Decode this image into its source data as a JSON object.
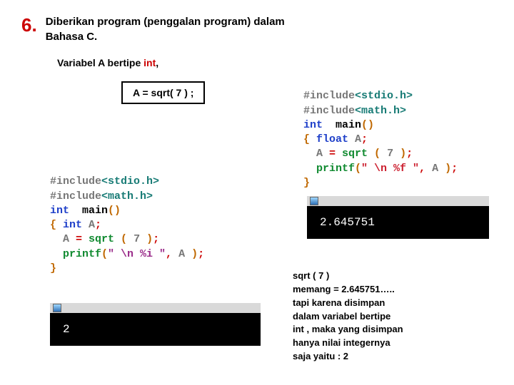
{
  "number": "6.",
  "title_line1": "Diberikan program (penggalan program) dalam",
  "title_line2": "Bahasa C.",
  "variable": {
    "pre": "Variabel   A   bertipe  ",
    "kw": "int",
    "post": ","
  },
  "formula": "A =  sqrt( 7 ) ;",
  "code_left": {
    "l1a": "#include",
    "l1b": "<stdio.h>",
    "l2a": "#include",
    "l2b": "<math.h>",
    "l3a": "int",
    "l3b": "  main",
    "l3c": "()",
    "l4a": "{",
    "l4b": " int",
    "l4c": " A",
    "l4d": ";",
    "l5a": "  A ",
    "l5b": "=",
    "l5c": " sqrt ",
    "l5d": "(",
    "l5e": " 7 ",
    "l5f": ")",
    "l5g": ";",
    "l6a": "  printf",
    "l6b": "(",
    "l6c": "\" \\n %i \"",
    "l6d": ", ",
    "l6e": "A ",
    "l6f": ")",
    "l6g": ";",
    "l7a": "}"
  },
  "code_right": {
    "l1a": "#include",
    "l1b": "<stdio.h>",
    "l2a": "#include",
    "l2b": "<math.h>",
    "l3a": "int",
    "l3b": "  main",
    "l3c": "()",
    "l4a": "{",
    "l4b": " float",
    "l4c": " A",
    "l4d": ";",
    "l5a": "  A ",
    "l5b": "=",
    "l5c": " sqrt ",
    "l5d": "(",
    "l5e": " 7 ",
    "l5f": ")",
    "l5g": ";",
    "l6a": "  printf",
    "l6b": "(",
    "l6c": "\" \\n %f \"",
    "l6d": ", ",
    "l6e": "A ",
    "l6f": ")",
    "l6g": ";",
    "l7a": "}"
  },
  "output_left": "2",
  "output_right": "2.645751",
  "explain": {
    "l1": "sqrt ( 7 )",
    "l2": "memang = 2.645751…..",
    "l3": "tapi karena disimpan",
    "l4": "dalam variabel bertipe",
    "l5": "int ,  maka yang disimpan",
    "l6": "hanya nilai integernya",
    "l7": "saja yaitu :  2"
  }
}
